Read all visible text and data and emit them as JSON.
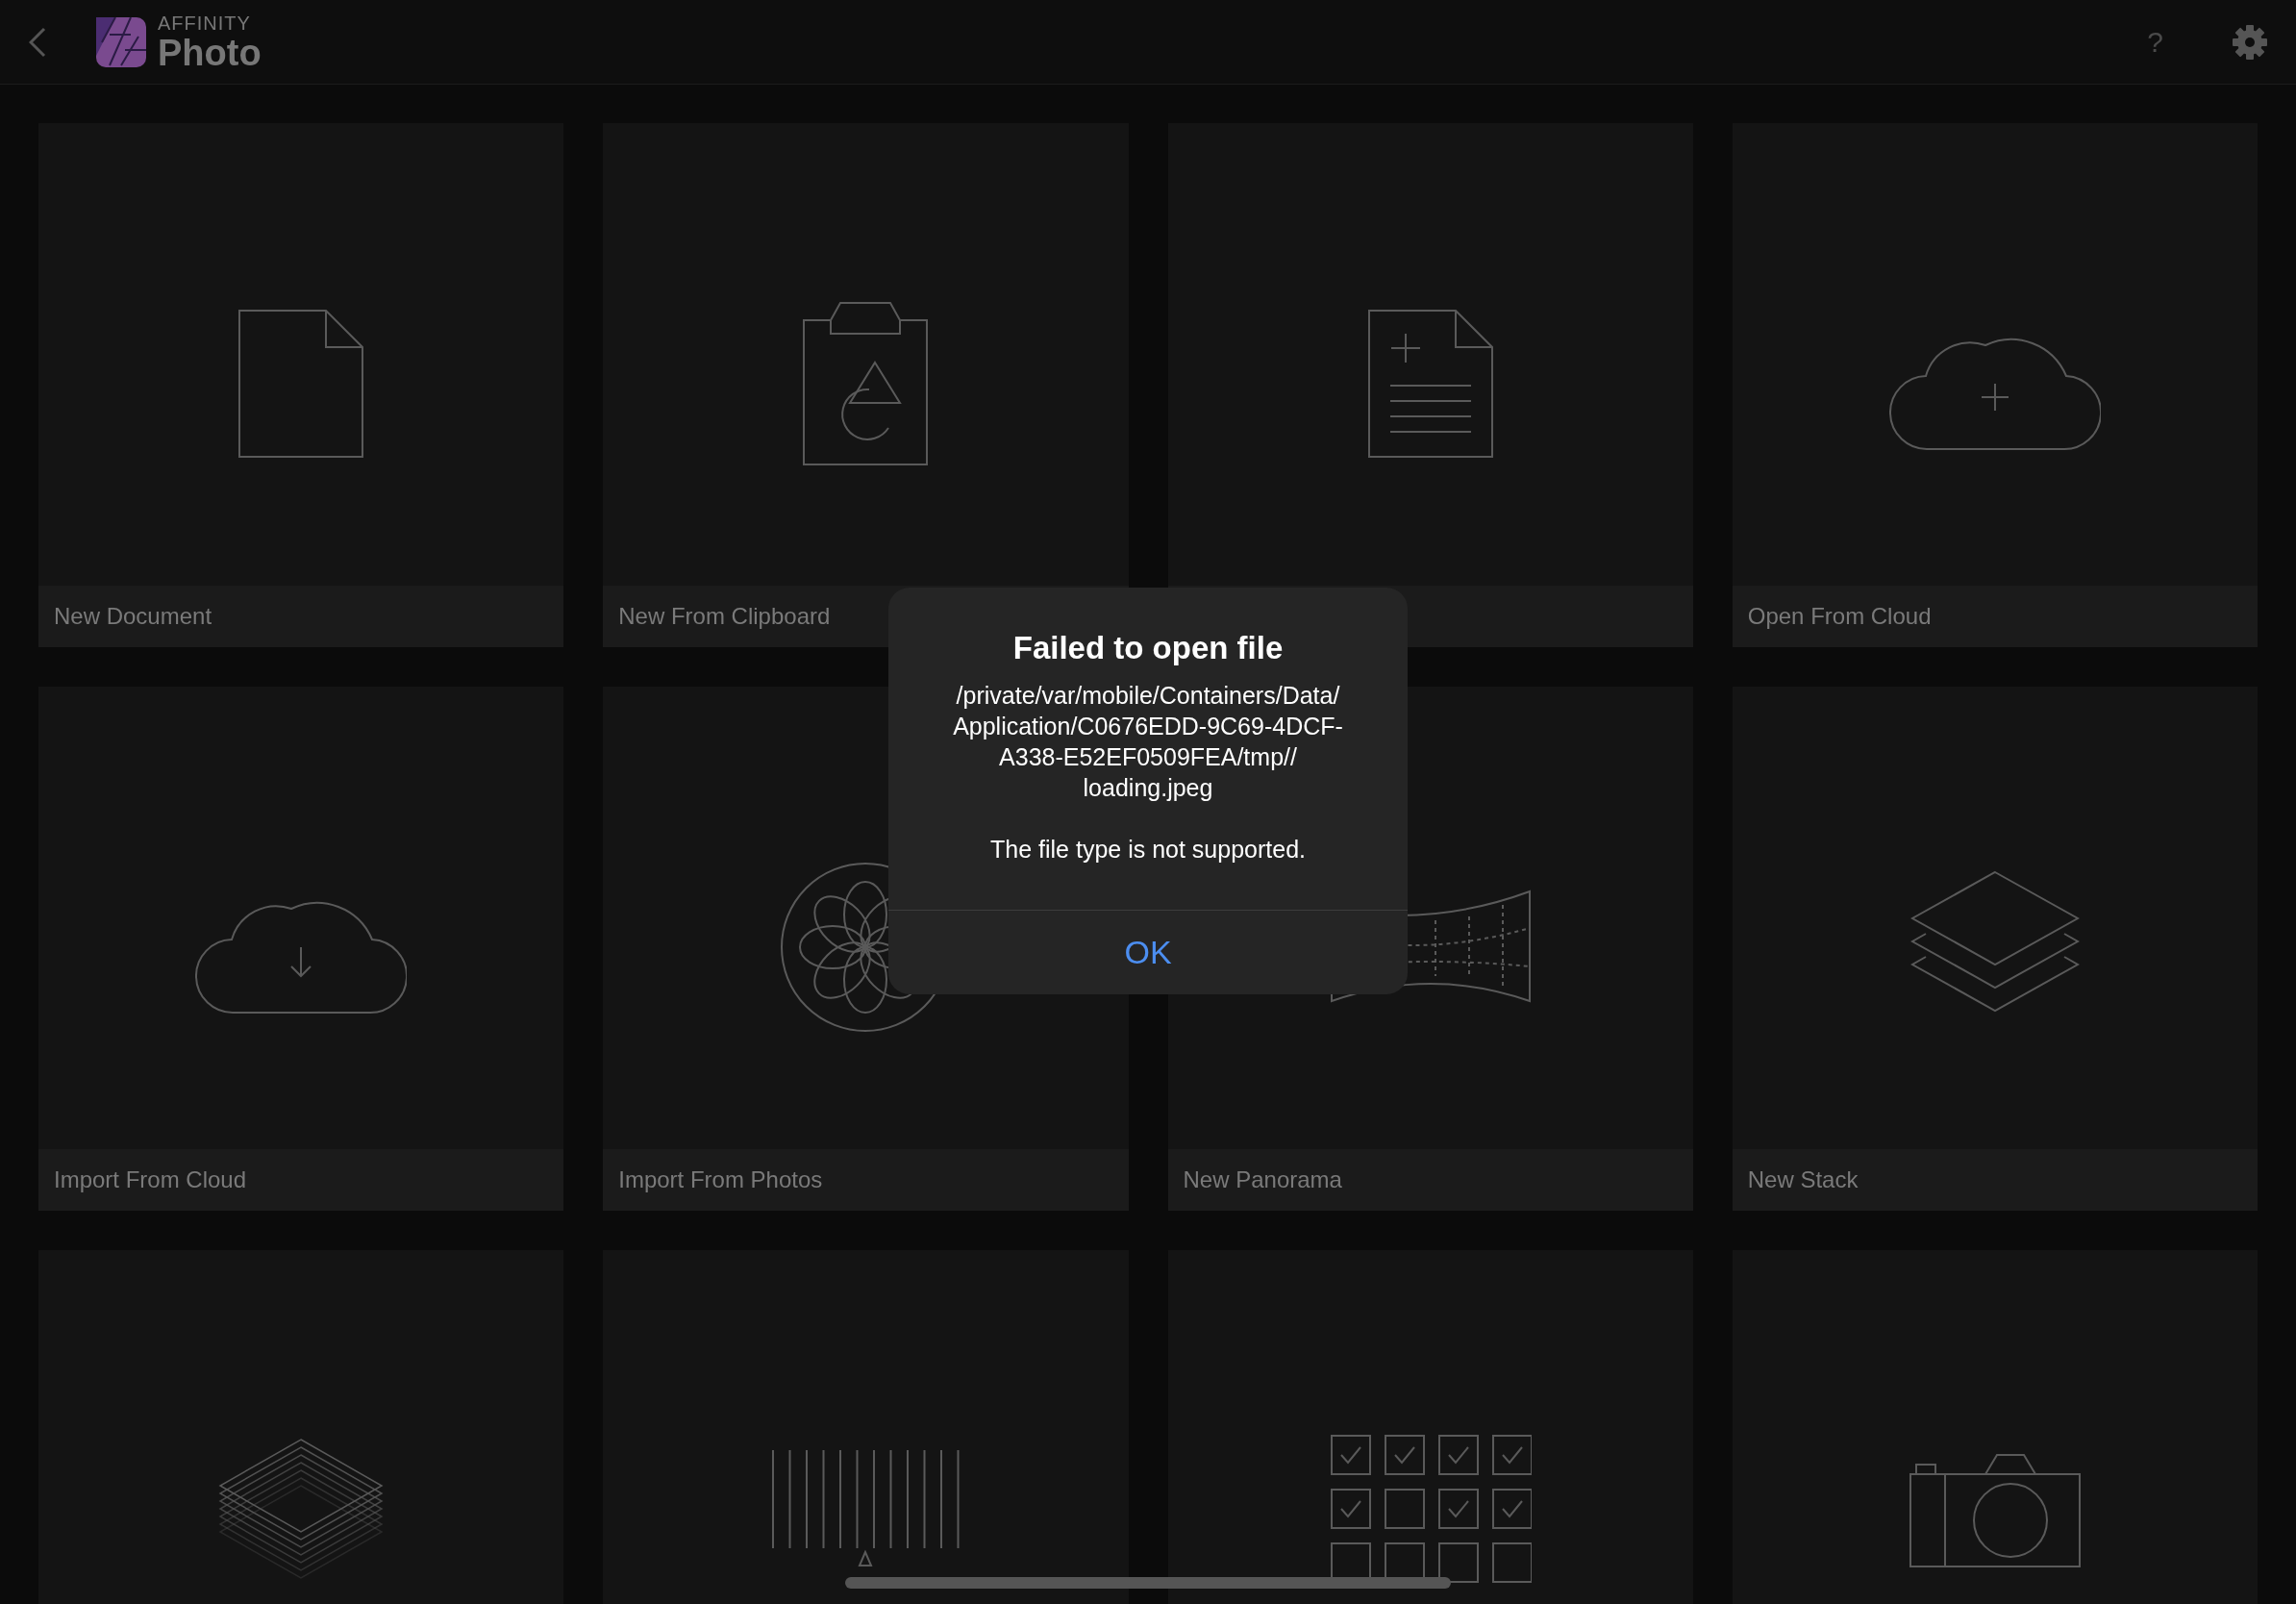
{
  "header": {
    "brand_top": "AFFINITY",
    "brand_name": "Photo",
    "help": "?"
  },
  "cards": [
    {
      "kind": "document",
      "label": "New Document"
    },
    {
      "kind": "clipboard",
      "label": "New From Clipboard"
    },
    {
      "kind": "template",
      "footer": true
    },
    {
      "kind": "cloud-plus",
      "label": "Open From Cloud"
    },
    {
      "kind": "cloud-down",
      "label": "Import From Cloud"
    },
    {
      "kind": "flower",
      "label": "Import From Photos"
    },
    {
      "kind": "panorama",
      "label": "New Panorama"
    },
    {
      "kind": "stack",
      "label": "New Stack"
    },
    {
      "kind": "layers"
    },
    {
      "kind": "bars"
    },
    {
      "kind": "checks"
    },
    {
      "kind": "camera"
    }
  ],
  "dialog": {
    "title": "Failed to open file",
    "path": [
      "/private/var/mobile/Containers/Data/",
      "Application/C0676EDD-9C69-4DCF-",
      "A338-E52EF0509FEA/tmp//",
      "loading.jpeg"
    ],
    "message": "The file type is not supported.",
    "button": "OK"
  }
}
